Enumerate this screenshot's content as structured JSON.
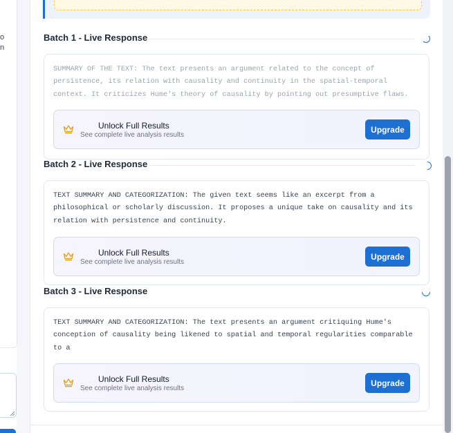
{
  "left_panel": {
    "text_lines": [
      "o",
      "n"
    ]
  },
  "batches": [
    {
      "title": "Batch 1 - Live Response",
      "text": "SUMMARY OF THE TEXT: The text presents an argument related to the concept of persistence, its relation with causality and continuity in the spatial-temporal context. It criticizes Hume's theory of causality by pointing out presumptive flaws.",
      "text_style": "dim",
      "unlock_title": "Unlock Full Results",
      "unlock_subtitle": "See complete live analysis results",
      "upgrade_label": "Upgrade"
    },
    {
      "title": "Batch 2 - Live Response",
      "text": "TEXT SUMMARY AND CATEGORIZATION: The given text seems like an excerpt from a philosophical or scholarly discussion. It proposes a unique take on causality and its relation with persistence and continuity.",
      "text_style": "dark",
      "unlock_title": "Unlock Full Results",
      "unlock_subtitle": "See complete live analysis results",
      "upgrade_label": "Upgrade"
    },
    {
      "title": "Batch 3 - Live Response",
      "text": "TEXT SUMMARY AND CATEGORIZATION: The text presents an argument critiquing Hume's conception of causality being likened to spatial and temporal regularities comparable to a",
      "text_style": "dark",
      "unlock_title": "Unlock Full Results",
      "unlock_subtitle": "See complete live analysis results",
      "upgrade_label": "Upgrade"
    }
  ],
  "colors": {
    "accent": "#1d6fd1",
    "crown": "#e0a81a",
    "dashed_border": "#f2c94c"
  },
  "icons": {
    "crown": "crown-icon",
    "spinner": "loading-spinner-icon"
  }
}
